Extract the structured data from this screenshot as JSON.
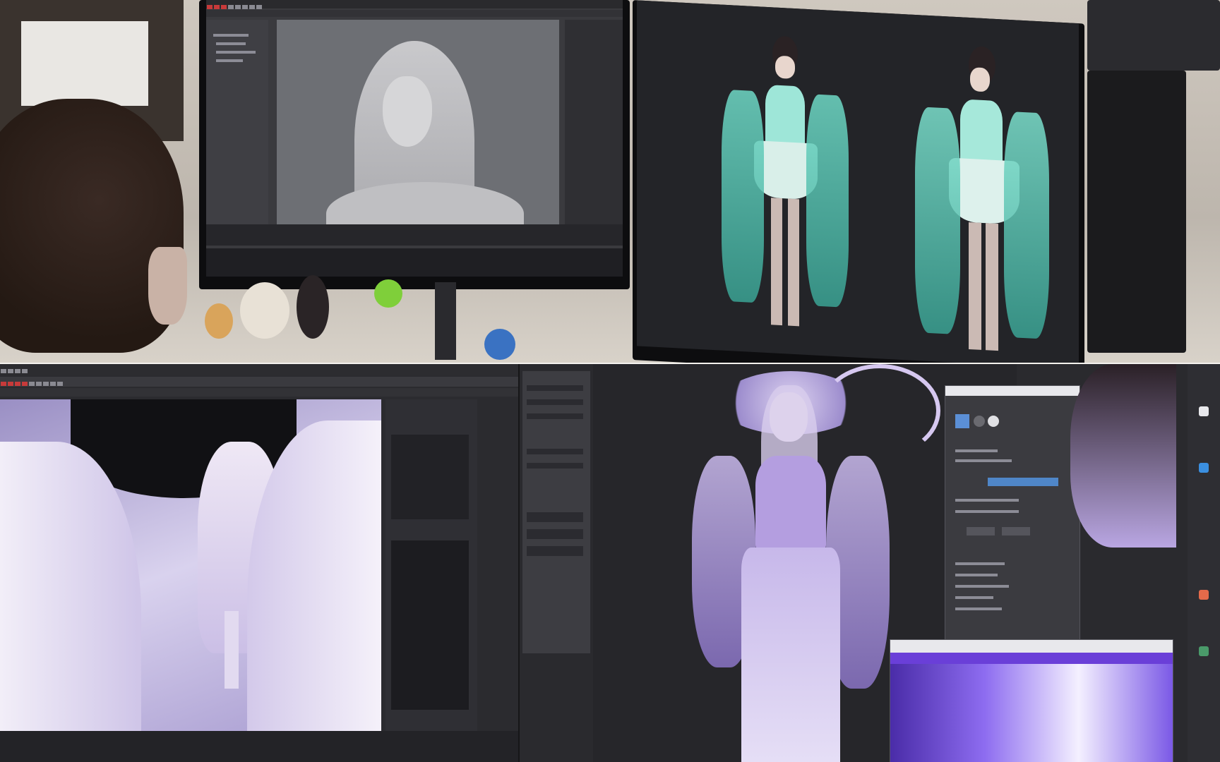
{
  "scene": {
    "description_none": "",
    "colors": {
      "desk": "#cfc8bf",
      "monitor_bezel": "#0d0d0f",
      "ui_dark": "#3a3a3e",
      "teal_costume": "#7fd6c8",
      "lilac_costume": "#b9a6e2",
      "viewport_gray": "#6d6f74"
    }
  },
  "icons": {
    "apps": [
      "maya-icon",
      "render-icon",
      "browser-icon",
      "folder-icon"
    ]
  }
}
